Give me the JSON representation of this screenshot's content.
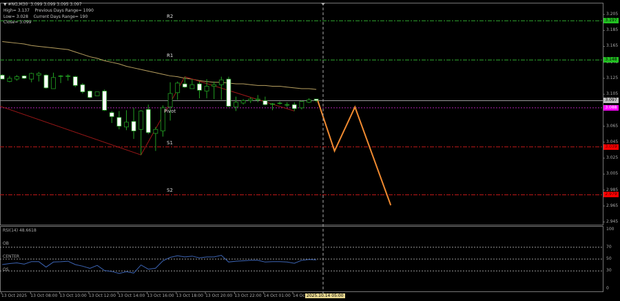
{
  "header": {
    "symbol_line": "#NG,M30  3.099 3.099 3.095 3.097",
    "high": "High= 3.137",
    "prev_range": "Previous Days Range= 1090",
    "low": "Low= 3.028",
    "cur_range": "Current Days Range= 190",
    "close": "Close= 3.099"
  },
  "levels": [
    {
      "label": "R2",
      "price": 3.197,
      "tag": "3.197",
      "color": "#2ea82e",
      "tag_bg": "#22c022",
      "tag_fg": "#000"
    },
    {
      "label": "R1",
      "price": 3.148,
      "tag": "3.148",
      "color": "#2ea82e",
      "tag_bg": "#22c022",
      "tag_fg": "#000"
    },
    {
      "label": "Pivot",
      "price": 3.088,
      "tag": "3.088",
      "color": "#b020b0",
      "tag_bg": "#ff00ff",
      "tag_fg": "#fff"
    },
    {
      "label": "S1",
      "price": 3.039,
      "tag": "3.039",
      "color": "#c01818",
      "tag_bg": "#ff0000",
      "tag_fg": "#400"
    },
    {
      "label": "S2",
      "price": 2.979,
      "tag": "2.979",
      "color": "#c01818",
      "tag_bg": "#ff0000",
      "tag_fg": "#400"
    }
  ],
  "current_price": {
    "value": 3.097,
    "tag": "3.097",
    "color": "#9a9a9a"
  },
  "price_axis": [
    "3.205",
    "3.185",
    "3.165",
    "3.145",
    "3.125",
    "3.105",
    "3.085",
    "3.065",
    "3.045",
    "3.025",
    "3.005",
    "2.985",
    "2.965",
    "2.945"
  ],
  "chart_data": {
    "type": "candlestick",
    "timeframe": "M30",
    "ylim": [
      2.94,
      3.21
    ],
    "ohlc": [
      [
        3.129,
        3.13,
        3.124,
        3.124
      ],
      [
        3.121,
        3.128,
        3.12,
        3.125
      ],
      [
        3.124,
        3.129,
        3.122,
        3.127
      ],
      [
        3.128,
        3.129,
        3.124,
        3.125
      ],
      [
        3.124,
        3.132,
        3.12,
        3.131
      ],
      [
        3.129,
        3.133,
        3.121,
        3.131
      ],
      [
        3.129,
        3.13,
        3.112,
        3.113
      ],
      [
        3.112,
        3.132,
        3.112,
        3.126
      ],
      [
        3.128,
        3.129,
        3.119,
        3.128
      ],
      [
        3.128,
        3.13,
        3.122,
        3.128
      ],
      [
        3.127,
        3.128,
        3.114,
        3.116
      ],
      [
        3.117,
        3.119,
        3.106,
        3.108
      ],
      [
        3.109,
        3.11,
        3.1,
        3.101
      ],
      [
        3.103,
        3.108,
        3.103,
        3.108
      ],
      [
        3.109,
        3.111,
        3.084,
        3.085
      ],
      [
        3.082,
        3.084,
        3.069,
        3.077
      ],
      [
        3.076,
        3.084,
        3.061,
        3.065
      ],
      [
        3.064,
        3.085,
        3.06,
        3.07
      ],
      [
        3.071,
        3.088,
        3.049,
        3.059
      ],
      [
        3.061,
        3.085,
        3.029,
        3.084
      ],
      [
        3.086,
        3.092,
        3.055,
        3.057
      ],
      [
        3.056,
        3.064,
        3.034,
        3.061
      ],
      [
        3.059,
        3.091,
        3.052,
        3.088
      ],
      [
        3.089,
        3.12,
        3.072,
        3.106
      ],
      [
        3.107,
        3.121,
        3.098,
        3.119
      ],
      [
        3.118,
        3.127,
        3.113,
        3.114
      ],
      [
        3.112,
        3.124,
        3.112,
        3.117
      ],
      [
        3.118,
        3.121,
        3.1,
        3.11
      ],
      [
        3.109,
        3.124,
        3.1,
        3.115
      ],
      [
        3.115,
        3.121,
        3.099,
        3.117
      ],
      [
        3.117,
        3.127,
        3.098,
        3.123
      ],
      [
        3.124,
        3.127,
        3.089,
        3.09
      ],
      [
        3.089,
        3.102,
        3.084,
        3.095
      ],
      [
        3.094,
        3.099,
        3.092,
        3.097
      ],
      [
        3.097,
        3.101,
        3.094,
        3.099
      ],
      [
        3.098,
        3.104,
        3.095,
        3.099
      ],
      [
        3.097,
        3.102,
        3.091,
        3.092
      ],
      [
        3.093,
        3.094,
        3.085,
        3.093
      ],
      [
        3.094,
        3.096,
        3.092,
        3.094
      ],
      [
        3.092,
        3.095,
        3.089,
        3.092
      ],
      [
        3.092,
        3.095,
        3.084,
        3.087
      ],
      [
        3.088,
        3.097,
        3.086,
        3.096
      ],
      [
        3.095,
        3.1,
        3.094,
        3.098
      ],
      [
        3.099,
        3.099,
        3.095,
        3.097
      ]
    ],
    "ma": [
      3.171,
      3.17,
      3.169,
      3.168,
      3.166,
      3.165,
      3.164,
      3.163,
      3.162,
      3.161,
      3.158,
      3.155,
      3.152,
      3.15,
      3.147,
      3.145,
      3.143,
      3.14,
      3.138,
      3.136,
      3.134,
      3.132,
      3.13,
      3.128,
      3.127,
      3.125,
      3.124,
      3.122,
      3.121,
      3.12,
      3.12,
      3.119,
      3.118,
      3.118,
      3.117,
      3.116,
      3.116,
      3.115,
      3.115,
      3.114,
      3.113,
      3.112,
      3.112,
      3.111
    ],
    "zigzag": [
      [
        -0.3,
        3.09
      ],
      [
        19,
        3.029
      ],
      [
        25,
        3.127
      ],
      [
        40,
        3.084
      ]
    ],
    "projection": [
      [
        43.2,
        3.097
      ],
      [
        45.5,
        3.034
      ],
      [
        48.3,
        3.089
      ],
      [
        53.2,
        2.966
      ]
    ],
    "colors": {
      "bull_body": "#000000",
      "bear_body": "#ffffff",
      "outline": "#22a022",
      "ma": "#b8a060",
      "zigzag": "#a01818",
      "projection": "#f08a30",
      "rsi": "#3c64b4"
    }
  },
  "rsi": {
    "title": "RSI(14) 48.6618",
    "ob_label": "OB",
    "center_label": "CENTER",
    "os_label": "OS",
    "axis": [
      "100",
      "70",
      "50",
      "30",
      "0"
    ],
    "values": [
      40.7,
      42.5,
      43.6,
      41.4,
      45.7,
      45.7,
      36.4,
      45,
      45.5,
      46.4,
      40.7,
      38,
      34.3,
      39.3,
      30.7,
      29,
      25.7,
      28.6,
      26.4,
      40,
      32.9,
      34.6,
      47.1,
      52.9,
      55.7,
      53.6,
      55,
      52.1,
      53.6,
      53.6,
      56.4,
      45,
      46.4,
      47.1,
      47.9,
      47.9,
      45,
      45.7,
      45.7,
      45,
      42.9,
      47.9,
      49.3,
      48.7
    ]
  },
  "time_axis": [
    "13 Oct 2025",
    "13 Oct 08:00",
    "13 Oct 10:00",
    "13 Oct 12:00",
    "13 Oct 14:00",
    "13 Oct 16:00",
    "13 Oct 18:00",
    "13 Oct 20:00",
    "13 Oct 22:00",
    "14 Oct 01:00",
    "14 Oc"
  ],
  "cursor_time": "2025.10.14 05:00"
}
